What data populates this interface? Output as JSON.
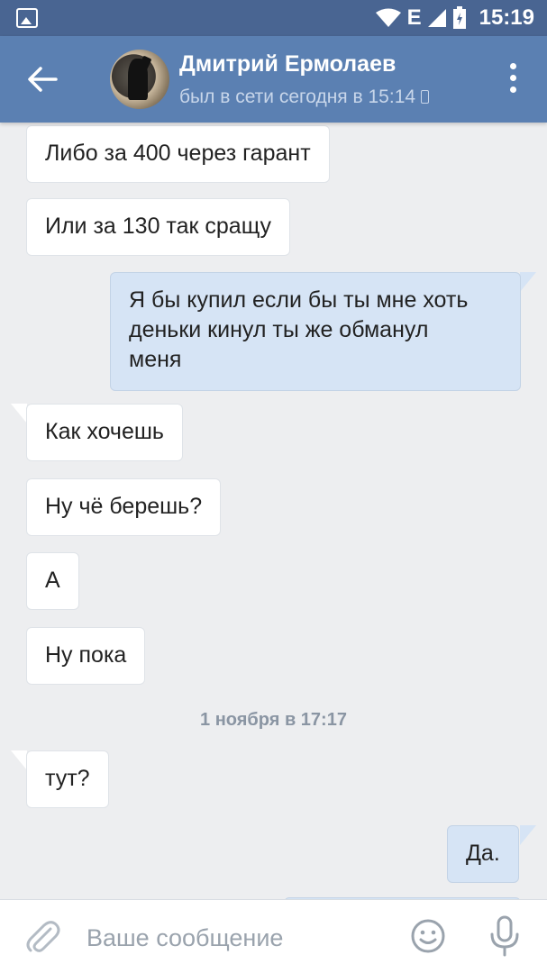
{
  "status_bar": {
    "time": "15:19",
    "network": "E",
    "icons": [
      "image-notification-icon",
      "wifi-icon",
      "signal-icon",
      "battery-icon"
    ]
  },
  "header": {
    "contact_name": "Дмитрий Ермолаев",
    "last_seen": "был в сети сегодня в 15:14",
    "icons": [
      "back-arrow-icon",
      "avatar",
      "mobile-phone-icon",
      "more-vertical-icon"
    ],
    "colors": {
      "status_bar": "#496592",
      "header": "#5b80b2"
    }
  },
  "messages": [
    {
      "direction": "incoming",
      "text": "Либо за 400 через гарант"
    },
    {
      "direction": "incoming",
      "text": "Или за 130 так сращу"
    },
    {
      "direction": "outgoing",
      "lines": [
        "Я бы купил если бы ты мне хоть",
        "деньки кинул ты же обманул",
        "меня"
      ]
    },
    {
      "direction": "incoming",
      "text": "Как хочешь"
    },
    {
      "direction": "incoming",
      "text": "Ну чё берешь?"
    },
    {
      "direction": "incoming",
      "text": "А"
    },
    {
      "direction": "incoming",
      "text": "Ну пока"
    },
    {
      "type": "date_separator",
      "text": "1 ноября в 17:17"
    },
    {
      "direction": "incoming",
      "text": "тут?"
    },
    {
      "direction": "outgoing",
      "text": "Да."
    }
  ],
  "composer": {
    "placeholder": "Ваше сообщение",
    "icons": [
      "attach-paperclip-icon",
      "emoji-smile-icon",
      "microphone-icon"
    ]
  },
  "colors": {
    "chat_background": "#edeef0",
    "incoming_bubble": "#ffffff",
    "outgoing_bubble": "#d6e4f5"
  }
}
